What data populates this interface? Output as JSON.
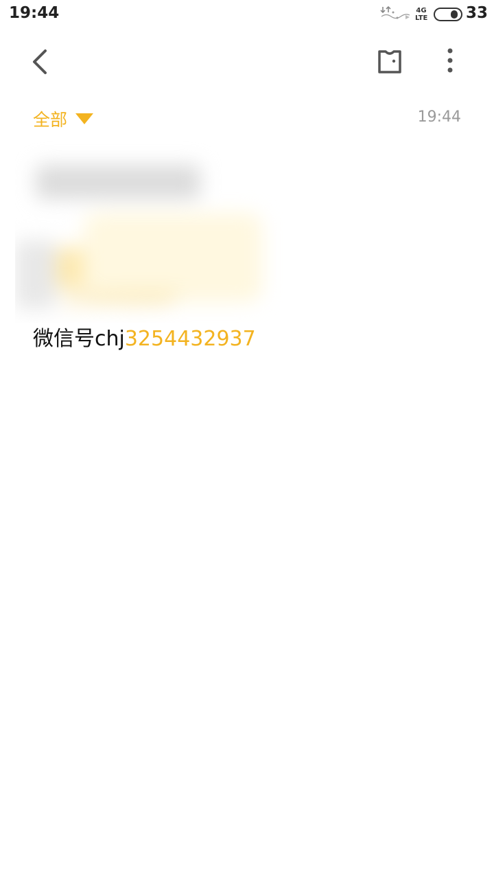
{
  "status_bar": {
    "time": "19:44",
    "network_top": "4G",
    "network_bottom": "LTE",
    "battery_level": "33"
  },
  "toolbar": {
    "back_icon": "chevron-left-icon",
    "tag_icon": "tag-icon",
    "more_icon": "more-vertical-icon"
  },
  "note": {
    "category": "全部",
    "time": "19:44",
    "text_prefix": "微信号chj",
    "link_number": "3254432937",
    "image_faded_text": "3254432937"
  },
  "colors": {
    "accent": "#f3b320",
    "time_gray": "#9a9a9a",
    "text": "#111111"
  }
}
